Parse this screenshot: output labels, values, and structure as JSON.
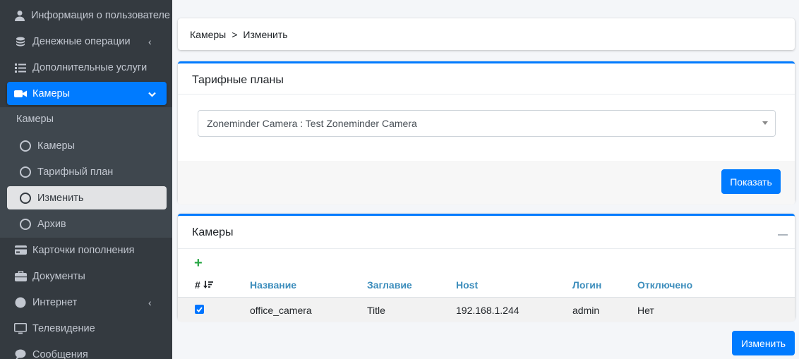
{
  "sidebar": {
    "items": [
      {
        "label": "Информация о пользователе",
        "icon": "user-icon"
      },
      {
        "label": "Денежные операции",
        "icon": "coins-icon"
      },
      {
        "label": "Дополнительные услуги",
        "icon": "list-icon"
      },
      {
        "label": "Камеры",
        "icon": "video-camera-icon"
      },
      {
        "label": "Карточки пополнения",
        "icon": "credit-card-icon"
      },
      {
        "label": "Документы",
        "icon": "briefcase-icon"
      },
      {
        "label": "Интернет",
        "icon": "globe-icon"
      },
      {
        "label": "Телевидение",
        "icon": "monitor-icon"
      },
      {
        "label": "Сообщения",
        "icon": "chat-icon"
      }
    ],
    "submenu_header": "Камеры",
    "submenu": [
      {
        "label": "Камеры"
      },
      {
        "label": "Тарифный план"
      },
      {
        "label": "Изменить"
      },
      {
        "label": "Архив"
      }
    ]
  },
  "breadcrumb": {
    "parent": "Камеры",
    "separator": ">",
    "current": "Изменить"
  },
  "tariff": {
    "title": "Тарифные планы",
    "selected": "Zoneminder Camera : Test Zoneminder Camera",
    "show_button": "Показать"
  },
  "cameras": {
    "title": "Камеры",
    "headers": {
      "hash": "#",
      "name": "Название",
      "title": "Заглавие",
      "host": "Host",
      "login": "Логин",
      "disabled": "Отключено"
    },
    "rows": [
      {
        "checked": true,
        "name": "office_camera",
        "title": "Title",
        "host": "192.168.1.244",
        "login": "admin",
        "disabled": "Нет"
      }
    ]
  },
  "submit_button": "Изменить",
  "colors": {
    "accent": "#007bff",
    "sidebar": "#343a40",
    "add": "#28a745",
    "header_link": "#3c8dbc"
  }
}
